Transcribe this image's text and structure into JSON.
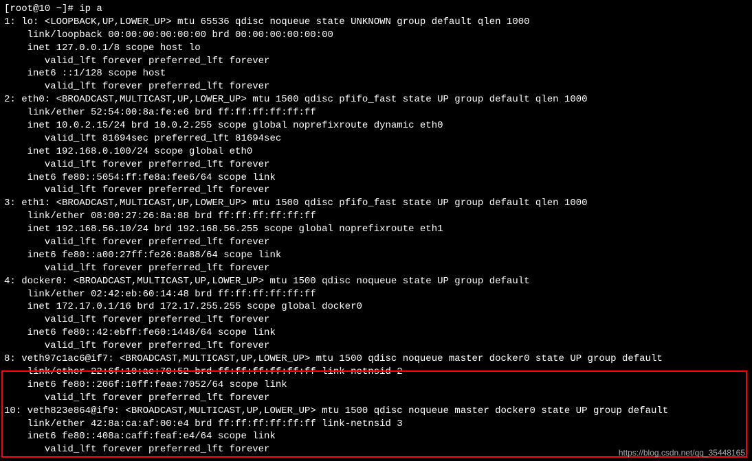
{
  "prompt": "[root@10 ~]# ip a",
  "output_lines": [
    "1: lo: <LOOPBACK,UP,LOWER_UP> mtu 65536 qdisc noqueue state UNKNOWN group default qlen 1000",
    "    link/loopback 00:00:00:00:00:00 brd 00:00:00:00:00:00",
    "    inet 127.0.0.1/8 scope host lo",
    "       valid_lft forever preferred_lft forever",
    "    inet6 ::1/128 scope host",
    "       valid_lft forever preferred_lft forever",
    "2: eth0: <BROADCAST,MULTICAST,UP,LOWER_UP> mtu 1500 qdisc pfifo_fast state UP group default qlen 1000",
    "    link/ether 52:54:00:8a:fe:e6 brd ff:ff:ff:ff:ff:ff",
    "    inet 10.0.2.15/24 brd 10.0.2.255 scope global noprefixroute dynamic eth0",
    "       valid_lft 81694sec preferred_lft 81694sec",
    "    inet 192.168.0.100/24 scope global eth0",
    "       valid_lft forever preferred_lft forever",
    "    inet6 fe80::5054:ff:fe8a:fee6/64 scope link",
    "       valid_lft forever preferred_lft forever",
    "3: eth1: <BROADCAST,MULTICAST,UP,LOWER_UP> mtu 1500 qdisc pfifo_fast state UP group default qlen 1000",
    "    link/ether 08:00:27:26:8a:88 brd ff:ff:ff:ff:ff:ff",
    "    inet 192.168.56.10/24 brd 192.168.56.255 scope global noprefixroute eth1",
    "       valid_lft forever preferred_lft forever",
    "    inet6 fe80::a00:27ff:fe26:8a88/64 scope link",
    "       valid_lft forever preferred_lft forever",
    "4: docker0: <BROADCAST,MULTICAST,UP,LOWER_UP> mtu 1500 qdisc noqueue state UP group default",
    "    link/ether 02:42:eb:60:14:48 brd ff:ff:ff:ff:ff:ff",
    "    inet 172.17.0.1/16 brd 172.17.255.255 scope global docker0",
    "       valid_lft forever preferred_lft forever",
    "    inet6 fe80::42:ebff:fe60:1448/64 scope link",
    "       valid_lft forever preferred_lft forever",
    "8: veth97c1ac6@if7: <BROADCAST,MULTICAST,UP,LOWER_UP> mtu 1500 qdisc noqueue master docker0 state UP group default",
    "    link/ether 22:6f:10:ae:70:52 brd ff:ff:ff:ff:ff:ff link-netnsid 2",
    "    inet6 fe80::206f:10ff:feae:7052/64 scope link",
    "       valid_lft forever preferred_lft forever",
    "10: veth823e864@if9: <BROADCAST,MULTICAST,UP,LOWER_UP> mtu 1500 qdisc noqueue master docker0 state UP group default",
    "    link/ether 42:8a:ca:af:00:e4 brd ff:ff:ff:ff:ff:ff link-netnsid 3",
    "    inet6 fe80::408a:caff:feaf:e4/64 scope link",
    "       valid_lft forever preferred_lft forever"
  ],
  "watermark": "https://blog.csdn.net/qq_35448165"
}
